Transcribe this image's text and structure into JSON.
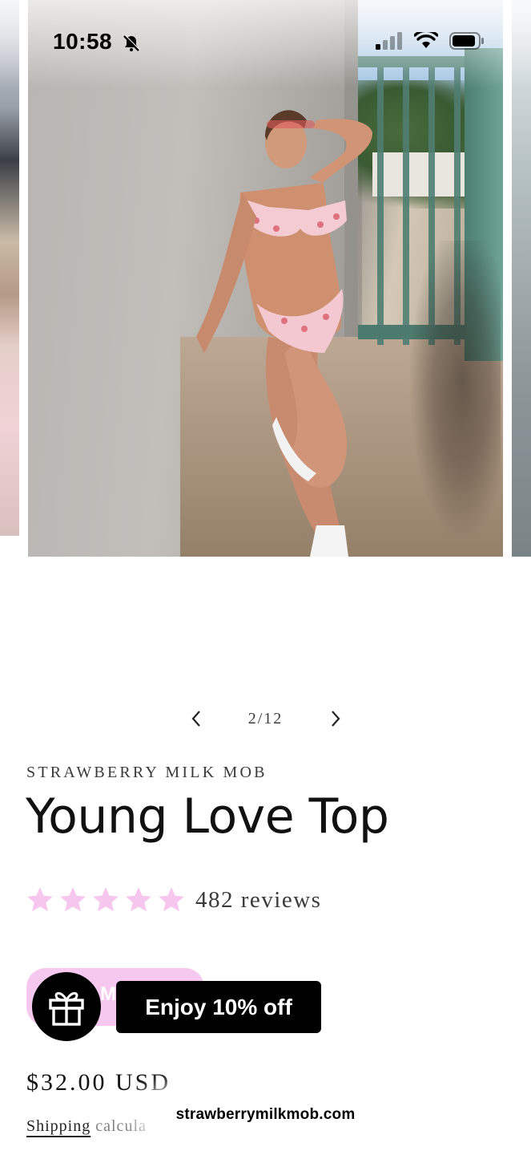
{
  "status_bar": {
    "time": "10:58",
    "icons": [
      "bell-slash-icon",
      "cellular-signal-icon",
      "wifi-icon",
      "battery-icon"
    ]
  },
  "gallery": {
    "counter": "2/12",
    "image_description_icon": "product-photo"
  },
  "product": {
    "vendor": "STRAWBERRY MILK MOB",
    "title": "Young Love Top",
    "rating_stars": 5,
    "reviews": "482 reviews",
    "button_label": "M",
    "price": "$32.00 USD",
    "shipping_link": "Shipping",
    "shipping_rest": "calcula"
  },
  "promo": {
    "label": "Enjoy 10% off",
    "icon": "gift-icon"
  },
  "browser": {
    "url": "strawberrymilkmob.com"
  },
  "colors": {
    "star": "#f7c6ee",
    "accent_pink": "#f7c8ef",
    "promo_bg": "#000000"
  }
}
